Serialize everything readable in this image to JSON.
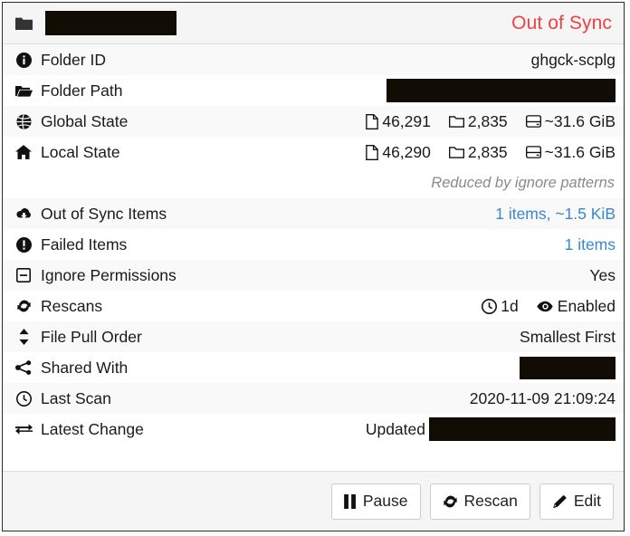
{
  "header": {
    "folder_icon": "folder-icon",
    "folder_name": "",
    "status": "Out of Sync",
    "status_color": "#f04040"
  },
  "rows": [
    {
      "icon": "info-circle-icon",
      "label": "Folder ID",
      "value": "ghgck-scplg"
    },
    {
      "icon": "folder-open-icon",
      "label": "Folder Path",
      "value": ""
    },
    {
      "icon": "globe-icon",
      "label": "Global State",
      "files_icon": "file-icon",
      "files": "46,291",
      "folders_icon": "folder-outline-icon",
      "folders": "2,835",
      "size_icon": "hard-drive-icon",
      "size": "~31.6 GiB"
    },
    {
      "icon": "home-icon",
      "label": "Local State",
      "files_icon": "file-icon",
      "files": "46,290",
      "folders_icon": "folder-outline-icon",
      "folders": "2,835",
      "size_icon": "hard-drive-icon",
      "size": "~31.6 GiB"
    },
    {
      "note": "Reduced by ignore patterns"
    },
    {
      "icon": "cloud-download-icon",
      "label": "Out of Sync Items",
      "value": "1 items, ~1.5 KiB",
      "link": true
    },
    {
      "icon": "exclamation-circle-icon",
      "label": "Failed Items",
      "value": "1 items",
      "link": true
    },
    {
      "icon": "minus-square-icon",
      "label": "Ignore Permissions",
      "value": "Yes"
    },
    {
      "icon": "refresh-icon",
      "label": "Rescans",
      "interval_icon": "clock-icon",
      "interval": "1d",
      "watch_icon": "eye-icon",
      "watch": "Enabled"
    },
    {
      "icon": "sort-icon",
      "label": "File Pull Order",
      "value": "Smallest First"
    },
    {
      "icon": "share-alt-icon",
      "label": "Shared With",
      "value": ""
    },
    {
      "icon": "clock-icon",
      "label": "Last Scan",
      "value": "2020-11-09 21:09:24"
    },
    {
      "icon": "exchange-icon",
      "label": "Latest Change",
      "value": "Updated"
    }
  ],
  "footer": {
    "pause_icon": "pause-icon",
    "pause_label": "Pause",
    "rescan_icon": "refresh-icon",
    "rescan_label": "Rescan",
    "edit_icon": "pencil-icon",
    "edit_label": "Edit"
  },
  "colors": {
    "link": "#3a87d0",
    "status": "#f04040",
    "stripe": "#f9f9f9",
    "chrome": "#f5f5f5"
  }
}
